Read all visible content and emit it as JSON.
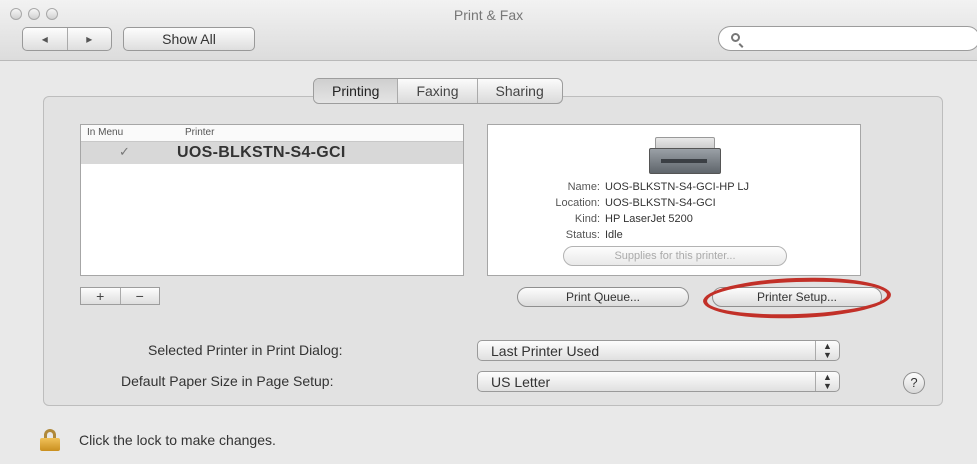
{
  "window": {
    "title": "Print & Fax"
  },
  "toolbar": {
    "back_label": "◂",
    "forward_label": "▸",
    "show_all_label": "Show All",
    "search_value": "",
    "search_placeholder": ""
  },
  "tabs": [
    {
      "label": "Printing",
      "active": true
    },
    {
      "label": "Faxing",
      "active": false
    },
    {
      "label": "Sharing",
      "active": false
    }
  ],
  "printer_list": {
    "headers": {
      "in_menu": "In Menu",
      "printer": "Printer"
    },
    "rows": [
      {
        "check": "✓",
        "name": "UOS-BLKSTN-S4-GCI",
        "selected": true
      }
    ]
  },
  "printer_details": {
    "name_label": "Name:",
    "name_value": "UOS-BLKSTN-S4-GCI-HP LJ",
    "location_label": "Location:",
    "location_value": "UOS-BLKSTN-S4-GCI",
    "kind_label": "Kind:",
    "kind_value": "HP LaserJet 5200",
    "status_label": "Status:",
    "status_value": "Idle",
    "supplies_label": "Supplies for this printer..."
  },
  "list_buttons": {
    "add_label": "+",
    "remove_label": "−"
  },
  "actions": {
    "print_queue_label": "Print Queue...",
    "printer_setup_label": "Printer Setup..."
  },
  "settings": {
    "selected_printer_label": "Selected Printer in Print Dialog:",
    "selected_printer_value": "Last Printer Used",
    "paper_size_label": "Default Paper Size in Page Setup:",
    "paper_size_value": "US Letter"
  },
  "help_label": "?",
  "lock": {
    "text": "Click the lock to make changes."
  },
  "colors": {
    "highlight_circle": "#c23028",
    "lock": "#e0a93a"
  }
}
